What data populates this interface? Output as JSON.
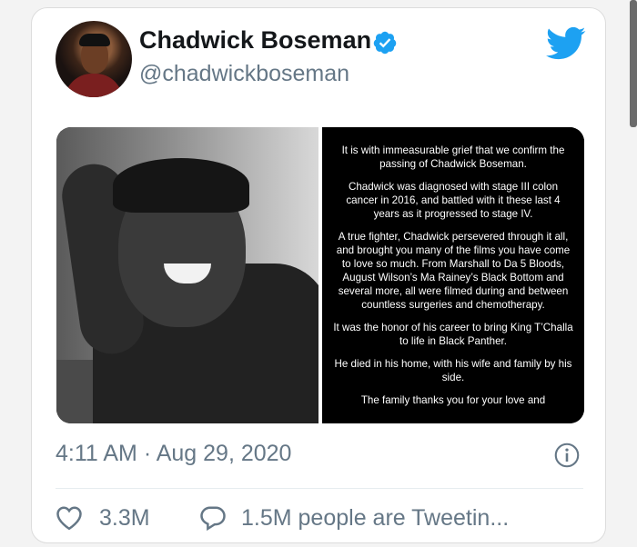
{
  "account": {
    "name": "Chadwick Boseman",
    "handle": "@chadwickboseman"
  },
  "colors": {
    "verified": "#1da1f2",
    "twitter_blue": "#1da1f2",
    "muted": "#657786"
  },
  "icons": {
    "verified": "verified-badge-icon",
    "brand": "twitter-bird-icon",
    "info": "info-icon",
    "like": "heart-icon",
    "reply": "speech-bubble-icon"
  },
  "statement": {
    "paragraphs": [
      "It is with immeasurable grief that we confirm the passing of Chadwick Boseman.",
      "Chadwick was diagnosed with stage III colon cancer in 2016, and battled with it these last 4 years as it progressed to stage IV.",
      "A true fighter, Chadwick persevered through it all, and brought you many of the films you have come to love so much. From Marshall to Da 5 Bloods, August Wilson’s Ma Rainey’s Black Bottom and several more, all were filmed during and between countless surgeries and chemotherapy.",
      "It was the honor of his career to bring King T’Challa to life in Black Panther.",
      "He died in his home, with his wife and family by his side.",
      "The family thanks you for your love and"
    ]
  },
  "tweet": {
    "timestamp": "4:11 AM · Aug 29, 2020",
    "likes": "3.3M",
    "tweeting": "1.5M people are Tweetin..."
  }
}
